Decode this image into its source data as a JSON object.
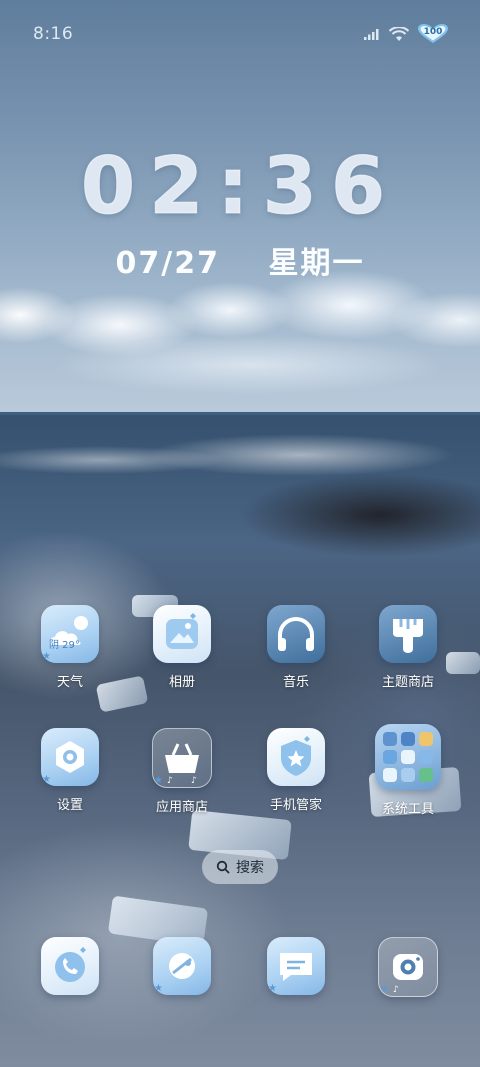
{
  "status_bar": {
    "time": "8:16",
    "battery": "100",
    "icons": [
      "signal-icon",
      "wifi-icon",
      "battery-icon"
    ]
  },
  "lockscreen": {
    "clock": "02:36",
    "date": "07/27",
    "weekday": "星期一"
  },
  "apps": {
    "weather": {
      "label": "天气",
      "temp": "阴 29°",
      "icon": "weather-icon"
    },
    "photos": {
      "label": "相册",
      "icon": "photo-icon"
    },
    "music": {
      "label": "音乐",
      "icon": "headphones-icon"
    },
    "themes": {
      "label": "主题商店",
      "icon": "paintbrush-icon"
    },
    "settings": {
      "label": "设置",
      "icon": "gear-icon"
    },
    "app_store": {
      "label": "应用商店",
      "icon": "basket-icon"
    },
    "phone_manager": {
      "label": "手机管家",
      "icon": "shield-icon"
    },
    "system_tools": {
      "label": "系统工具",
      "icon": "folder-icon"
    }
  },
  "search": {
    "label": "搜索",
    "icon": "search-icon"
  },
  "dock": {
    "items": [
      "phone-icon",
      "browser-icon",
      "messages-icon",
      "camera-icon"
    ]
  },
  "colors": {
    "accent": "#5a9ad8",
    "tile_light": "#e5f1fb"
  }
}
